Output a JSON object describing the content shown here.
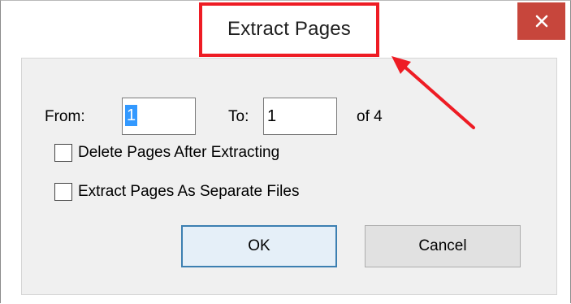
{
  "window": {
    "title": "Extract Pages",
    "close_symbol": "×"
  },
  "range": {
    "from_label": "From:",
    "from_value": "1",
    "to_label": "To:",
    "to_value": "1",
    "of_label": "of 4"
  },
  "options": [
    {
      "label": "Delete Pages After Extracting",
      "checked": false
    },
    {
      "label": "Extract Pages As Separate Files",
      "checked": false
    }
  ],
  "buttons": {
    "ok_label": "OK",
    "cancel_label": "Cancel"
  },
  "colors": {
    "annotation_red": "#ee1c24",
    "close_button": "#c7463c",
    "selection": "#3399ff",
    "default_button_border": "#3c7fb1"
  },
  "icons": {
    "close": "close-icon",
    "annotation_arrow": "arrow-annotation"
  }
}
